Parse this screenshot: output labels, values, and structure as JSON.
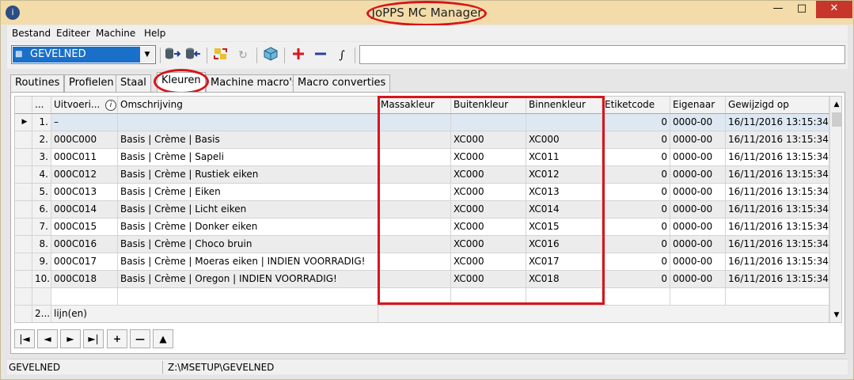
{
  "window": {
    "title": "JoPPS MC Manager",
    "minimize_glyph": "—",
    "maximize_glyph": "□",
    "close_glyph": "✕"
  },
  "menu": {
    "items": [
      "Bestand",
      "Editeer",
      "Machine",
      "Help"
    ]
  },
  "toolbar": {
    "machine_select_value": "GEVELNED",
    "icons": [
      "db-export-icon",
      "db-import-icon",
      "swap-icon",
      "redo-icon",
      "package-icon",
      "add-icon",
      "remove-icon",
      "script-icon"
    ]
  },
  "tabs": [
    {
      "label": "Routines",
      "active": false
    },
    {
      "label": "Profielen",
      "active": false
    },
    {
      "label": "Staal",
      "active": false
    },
    {
      "label": "Kleuren",
      "active": true
    },
    {
      "label": "Machine macro's",
      "active": false
    },
    {
      "label": "Macro converties",
      "active": false
    }
  ],
  "grid": {
    "columns": [
      "",
      "...",
      "Uitvoeri...",
      "Omschrijving",
      "Massakleur",
      "Buitenkleur",
      "Binnenkleur",
      "Etiketcode",
      "Eigenaar",
      "Gewijzigd op"
    ],
    "rows": [
      {
        "nr": "1.",
        "uitvoering": "–",
        "omschrijving": "",
        "massakleur": "",
        "buitenkleur": "",
        "binnenkleur": "",
        "etiketcode": "0",
        "eigenaar": "0000-00",
        "gewijzigd": "16/11/2016 13:15:34"
      },
      {
        "nr": "2.",
        "uitvoering": "000C000",
        "omschrijving": "Basis | Crème | Basis",
        "massakleur": "",
        "buitenkleur": "XC000",
        "binnenkleur": "XC000",
        "etiketcode": "0",
        "eigenaar": "0000-00",
        "gewijzigd": "16/11/2016 13:15:34"
      },
      {
        "nr": "3.",
        "uitvoering": "000C011",
        "omschrijving": "Basis | Crème | Sapeli",
        "massakleur": "",
        "buitenkleur": "XC000",
        "binnenkleur": "XC011",
        "etiketcode": "0",
        "eigenaar": "0000-00",
        "gewijzigd": "16/11/2016 13:15:34"
      },
      {
        "nr": "4.",
        "uitvoering": "000C012",
        "omschrijving": "Basis | Crème | Rustiek eiken",
        "massakleur": "",
        "buitenkleur": "XC000",
        "binnenkleur": "XC012",
        "etiketcode": "0",
        "eigenaar": "0000-00",
        "gewijzigd": "16/11/2016 13:15:34"
      },
      {
        "nr": "5.",
        "uitvoering": "000C013",
        "omschrijving": "Basis | Crème | Eiken",
        "massakleur": "",
        "buitenkleur": "XC000",
        "binnenkleur": "XC013",
        "etiketcode": "0",
        "eigenaar": "0000-00",
        "gewijzigd": "16/11/2016 13:15:34"
      },
      {
        "nr": "6.",
        "uitvoering": "000C014",
        "omschrijving": "Basis | Crème | Licht eiken",
        "massakleur": "",
        "buitenkleur": "XC000",
        "binnenkleur": "XC014",
        "etiketcode": "0",
        "eigenaar": "0000-00",
        "gewijzigd": "16/11/2016 13:15:34"
      },
      {
        "nr": "7.",
        "uitvoering": "000C015",
        "omschrijving": "Basis | Crème | Donker eiken",
        "massakleur": "",
        "buitenkleur": "XC000",
        "binnenkleur": "XC015",
        "etiketcode": "0",
        "eigenaar": "0000-00",
        "gewijzigd": "16/11/2016 13:15:34"
      },
      {
        "nr": "8.",
        "uitvoering": "000C016",
        "omschrijving": "Basis | Crème | Choco bruin",
        "massakleur": "",
        "buitenkleur": "XC000",
        "binnenkleur": "XC016",
        "etiketcode": "0",
        "eigenaar": "0000-00",
        "gewijzigd": "16/11/2016 13:15:34"
      },
      {
        "nr": "9.",
        "uitvoering": "000C017",
        "omschrijving": "Basis | Crème | Moeras eiken | INDIEN VOORRADIG!",
        "massakleur": "",
        "buitenkleur": "XC000",
        "binnenkleur": "XC017",
        "etiketcode": "0",
        "eigenaar": "0000-00",
        "gewijzigd": "16/11/2016 13:15:34"
      },
      {
        "nr": "10.",
        "uitvoering": "000C018",
        "omschrijving": "Basis | Crème | Oregon | INDIEN VOORRADIG!",
        "massakleur": "",
        "buitenkleur": "XC000",
        "binnenkleur": "XC018",
        "etiketcode": "0",
        "eigenaar": "0000-00",
        "gewijzigd": "16/11/2016 13:15:34"
      }
    ],
    "footer_count": "2...",
    "footer_label": "lijn(en)"
  },
  "nav": {
    "first": "|◄",
    "prev": "◄",
    "next": "►",
    "last": "►|",
    "add": "+",
    "remove": "—",
    "up": "▲"
  },
  "status": {
    "machine": "GEVELNED",
    "path": "Z:\\MSETUP\\GEVELNED"
  },
  "colors": {
    "titlebar": "#f3dca9",
    "selection": "#1a6fc9",
    "highlight_ring": "#d8141a",
    "add_icon": "#e0141b",
    "remove_icon": "#2a3fa0"
  }
}
